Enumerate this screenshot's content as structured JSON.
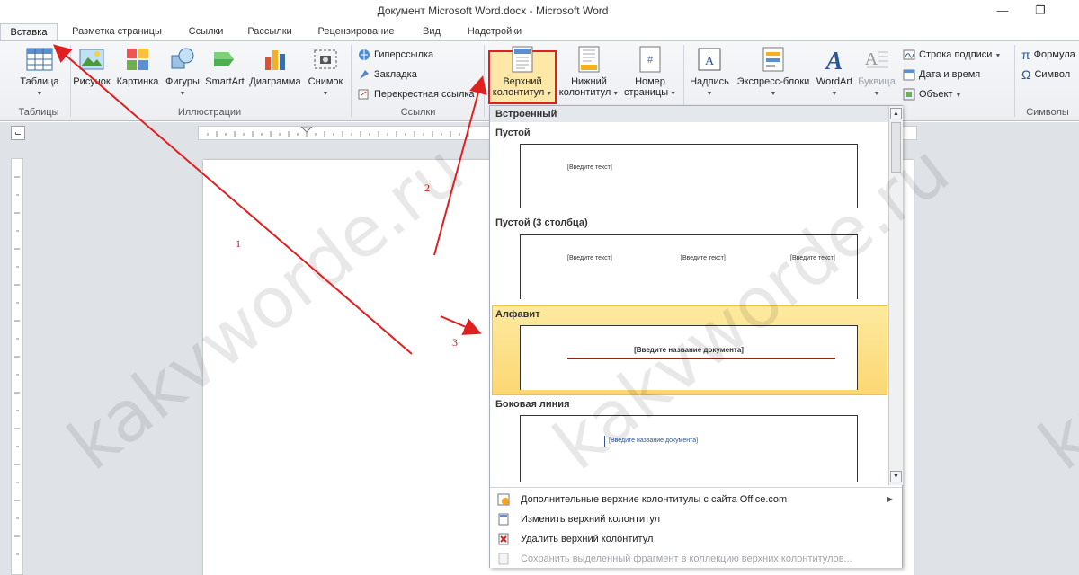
{
  "window": {
    "title": "Документ Microsoft Word.docx  -  Microsoft Word",
    "minimize_icon": "minimize-icon",
    "restore_icon": "restore-icon"
  },
  "tabs": [
    {
      "label": "Вставка",
      "active": true
    },
    {
      "label": "Разметка страницы"
    },
    {
      "label": "Ссылки"
    },
    {
      "label": "Рассылки"
    },
    {
      "label": "Рецензирование"
    },
    {
      "label": "Вид"
    },
    {
      "label": "Надстройки"
    }
  ],
  "ribbon": {
    "groups": {
      "tables": "Таблицы",
      "illustrations": "Иллюстрации",
      "links": "Ссылки",
      "symbols": "Символы"
    },
    "buttons": {
      "table": "Таблица",
      "picture": "Рисунок",
      "clipart": "Картинка",
      "shapes": "Фигуры",
      "smartart": "SmartArt",
      "chart": "Диаграмма",
      "screenshot": "Снимок",
      "hyperlink": "Гиперссылка",
      "bookmark": "Закладка",
      "crossref": "Перекрестная ссылка",
      "header_line1": "Верхний",
      "header_line2": "колонтитул",
      "footer_line1": "Нижний",
      "footer_line2": "колонтитул",
      "pagenum_line1": "Номер",
      "pagenum_line2": "страницы",
      "textbox": "Надпись",
      "quickparts": "Экспресс-блоки",
      "wordart": "WordArt",
      "dropcap": "Буквица",
      "signature": "Строка подписи",
      "datetime": "Дата и время",
      "object": "Объект",
      "formula": "Формула",
      "symbol": "Символ"
    }
  },
  "gallery": {
    "section": "Встроенный",
    "items": [
      {
        "title": "Пустой",
        "placeholder": "[Введите текст]"
      },
      {
        "title": "Пустой (3 столбца)",
        "placeholders": [
          "[Введите текст]",
          "[Введите текст]",
          "[Введите текст]"
        ]
      },
      {
        "title": "Алфавит",
        "placeholder": "[Введите название документа]",
        "highlighted": true
      },
      {
        "title": "Боковая линия",
        "placeholder": "[Введите название документа]"
      }
    ]
  },
  "menu": [
    {
      "label": "Дополнительные верхние колонтитулы с сайта Office.com",
      "icon": "office-online-icon",
      "submenu": true
    },
    {
      "label": "Изменить верхний колонтитул",
      "icon": "edit-header-icon"
    },
    {
      "label": "Удалить верхний колонтитул",
      "icon": "delete-header-icon"
    },
    {
      "label": "Сохранить выделенный фрагмент в коллекцию верхних колонтитулов...",
      "icon": "save-selection-icon",
      "disabled": true
    }
  ],
  "annotations": [
    "1",
    "2",
    "3"
  ],
  "watermark": "kakvworde.ru",
  "colors": {
    "annotation": "#e02020",
    "highlight": "#fbd772",
    "accent_blue": "#2b5797"
  }
}
